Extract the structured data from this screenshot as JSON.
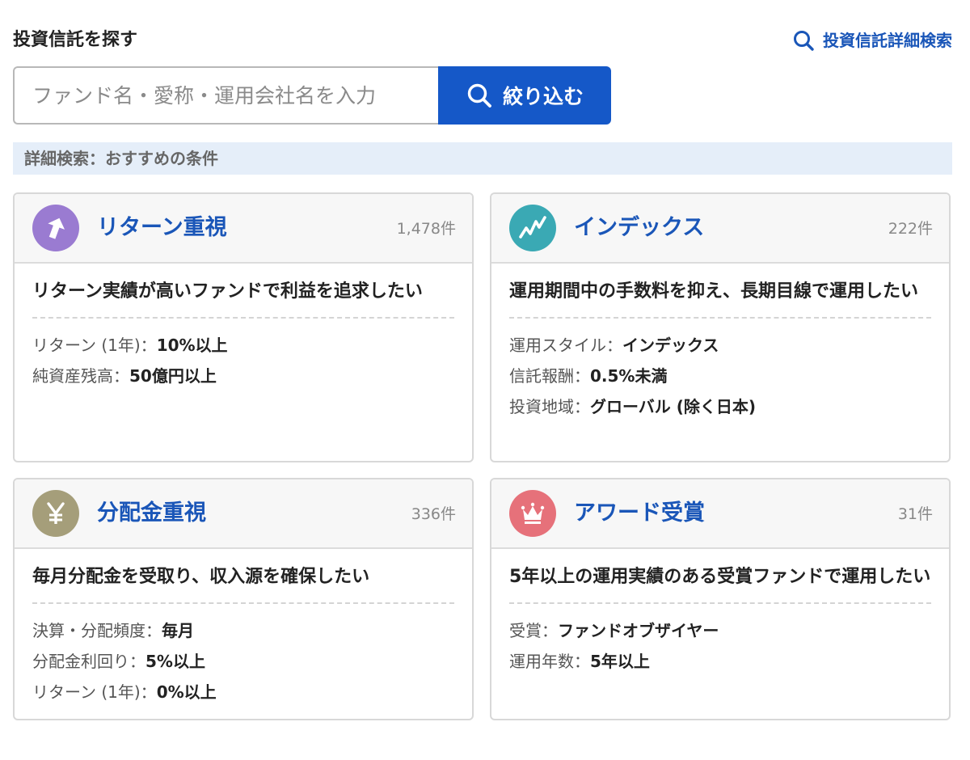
{
  "header": {
    "title": "投資信託を探す",
    "advanced_search_label": "投資信託詳細検索"
  },
  "search": {
    "placeholder": "ファンド名・愛称・運用会社名を入力",
    "button_label": "絞り込む"
  },
  "section": {
    "title": "詳細検索：おすすめの条件"
  },
  "colors": {
    "accent_blue": "#1558c8",
    "link_blue": "#1a56b8",
    "return_icon": "#9a7bd1",
    "index_icon": "#3aa9b4",
    "dividend_icon": "#a59e7a",
    "award_icon": "#e6717a"
  },
  "cards": [
    {
      "icon": "up-arrow-icon",
      "title": "リターン重視",
      "count": "1,478件",
      "description": "リターン実績が高いファンドで利益を追求したい",
      "criteria": [
        {
          "label": "リターン (1年)：",
          "value": "10%以上"
        },
        {
          "label": "純資産残高：",
          "value": "50億円以上"
        }
      ]
    },
    {
      "icon": "trend-line-icon",
      "title": "インデックス",
      "count": "222件",
      "description": "運用期間中の手数料を抑え、長期目線で運用したい",
      "criteria": [
        {
          "label": "運用スタイル：",
          "value": "インデックス"
        },
        {
          "label": "信託報酬：",
          "value": "0.5%未満"
        },
        {
          "label": "投資地域：",
          "value": "グローバル (除く日本)"
        }
      ]
    },
    {
      "icon": "yen-icon",
      "title": "分配金重視",
      "count": "336件",
      "description": "毎月分配金を受取り、収入源を確保したい",
      "criteria": [
        {
          "label": "決算・分配頻度：",
          "value": "毎月"
        },
        {
          "label": "分配金利回り：",
          "value": "5%以上"
        },
        {
          "label": "リターン (1年)：",
          "value": "0%以上"
        }
      ]
    },
    {
      "icon": "crown-icon",
      "title": "アワード受賞",
      "count": "31件",
      "description": "5年以上の運用実績のある受賞ファンドで運用したい",
      "criteria": [
        {
          "label": "受賞：",
          "value": "ファンドオブザイヤー"
        },
        {
          "label": "運用年数：",
          "value": "5年以上"
        }
      ]
    }
  ]
}
